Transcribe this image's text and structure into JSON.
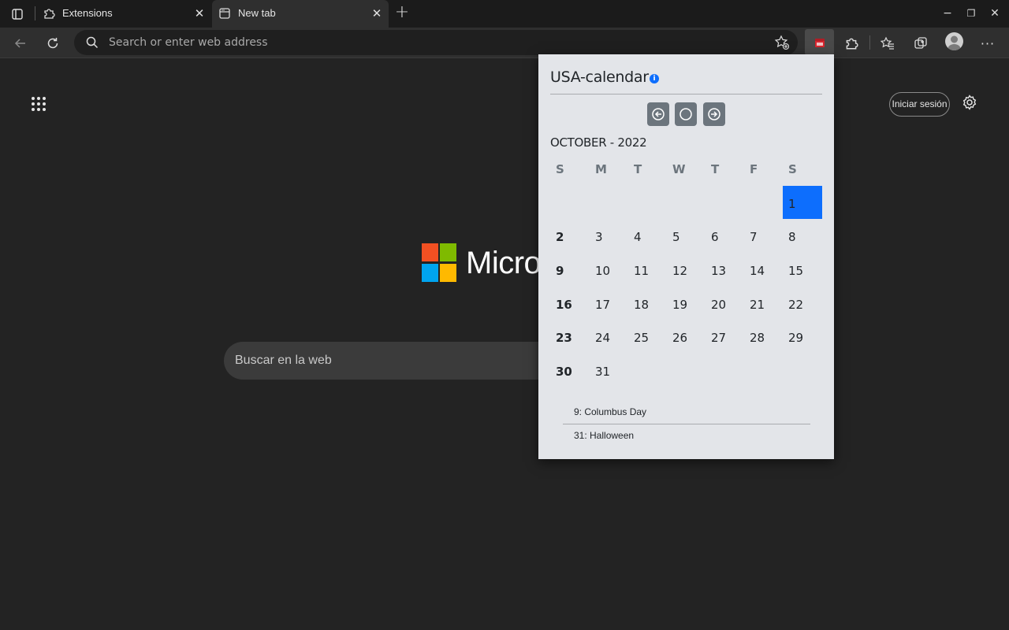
{
  "tabs": [
    {
      "title": "Extensions",
      "icon": "puzzle-icon",
      "active": false
    },
    {
      "title": "New tab",
      "icon": "newtab-icon",
      "active": true
    }
  ],
  "tab_close_glyph": "✕",
  "window_controls": {
    "minimize": "−",
    "restore": "❐",
    "close": "✕"
  },
  "address_bar": {
    "placeholder": "Search or enter web address",
    "value": ""
  },
  "new_tab_page": {
    "signin_label": "Iniciar sesión",
    "brand_text": "Micro",
    "search_placeholder": "Buscar en la web"
  },
  "popup": {
    "title": "USA-calendar",
    "month_label": "OCTOBER - 2022",
    "weekday_headers": [
      "S",
      "M",
      "T",
      "W",
      "T",
      "F",
      "S"
    ],
    "today": "1",
    "weeks": [
      [
        "",
        "",
        "",
        "",
        "",
        "",
        "1"
      ],
      [
        "2",
        "3",
        "4",
        "5",
        "6",
        "7",
        "8"
      ],
      [
        "9",
        "10",
        "11",
        "12",
        "13",
        "14",
        "15"
      ],
      [
        "16",
        "17",
        "18",
        "19",
        "20",
        "21",
        "22"
      ],
      [
        "23",
        "24",
        "25",
        "26",
        "27",
        "28",
        "29"
      ],
      [
        "30",
        "31",
        "",
        "",
        "",
        "",
        ""
      ]
    ],
    "holidays": [
      "9: Columbus Day",
      "31: Halloween"
    ],
    "accent_color": "#0d6efd"
  }
}
